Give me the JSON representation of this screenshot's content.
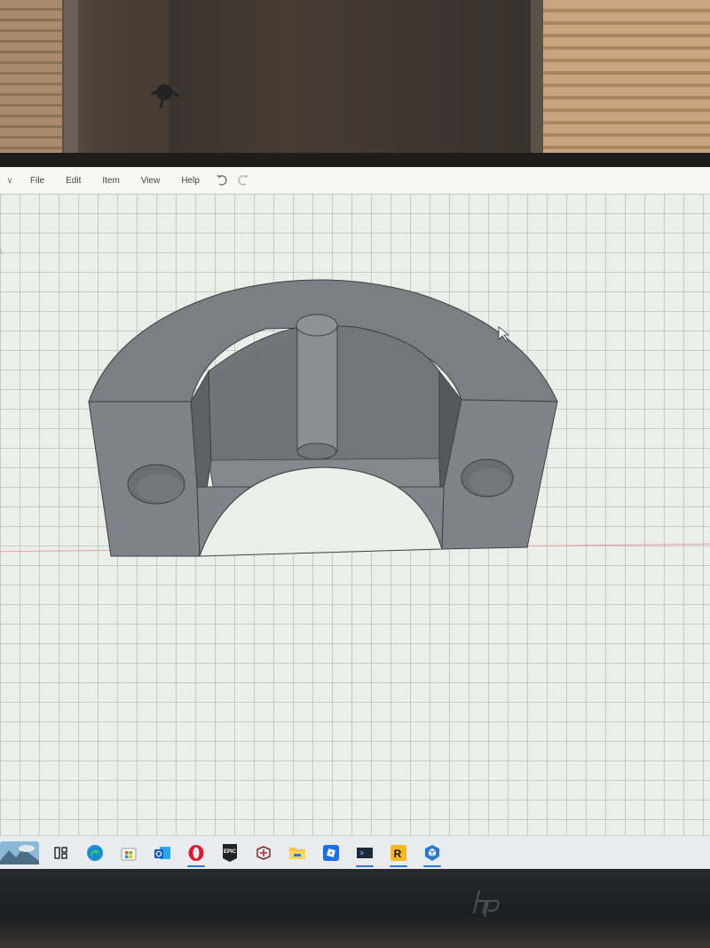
{
  "menubar": {
    "items": [
      "File",
      "Edit",
      "Item",
      "View",
      "Help"
    ]
  },
  "icons": {
    "undo": "undo-icon",
    "redo": "redo-icon",
    "menu_chevron": "chevron-down-icon"
  },
  "taskbar": {
    "apps": [
      {
        "name": "task-view",
        "icon": "task-view-icon",
        "active": false
      },
      {
        "name": "edge",
        "icon": "edge-icon",
        "active": false
      },
      {
        "name": "store",
        "icon": "microsoft-store-icon",
        "active": false
      },
      {
        "name": "outlook",
        "icon": "outlook-icon",
        "active": false
      },
      {
        "name": "opera",
        "icon": "opera-icon",
        "active": true
      },
      {
        "name": "epic-games",
        "icon": "epic-games-icon",
        "active": false
      },
      {
        "name": "game-launcher",
        "icon": "gamepad-icon",
        "active": false
      },
      {
        "name": "file-explorer",
        "icon": "folder-icon",
        "active": false
      },
      {
        "name": "roblox",
        "icon": "roblox-icon",
        "active": false
      },
      {
        "name": "terminal",
        "icon": "terminal-icon",
        "active": true
      },
      {
        "name": "rockstar",
        "icon": "rockstar-icon",
        "active": true
      },
      {
        "name": "3d-builder",
        "icon": "3d-builder-icon",
        "active": true
      }
    ],
    "epic_label": "EPIC",
    "rockstar_label": "R"
  },
  "colors": {
    "model_face": "#7d8185",
    "model_dark": "#5f6367",
    "axis_red": "#e6a39b",
    "accent": "#2b78d4"
  }
}
